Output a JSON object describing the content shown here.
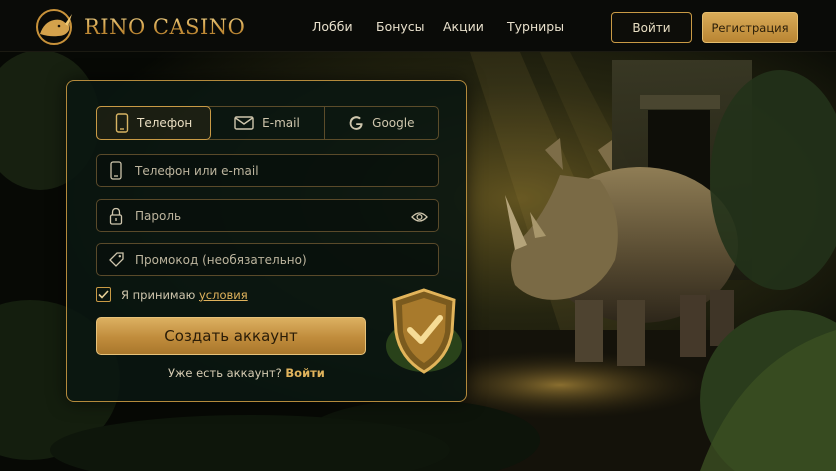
{
  "brand": {
    "name": "RINO CASINO"
  },
  "nav": {
    "items": [
      "Лобби",
      "Бонусы",
      "Акции",
      "Турниры"
    ]
  },
  "header": {
    "login_label": "Войти",
    "register_label": "Регистрация"
  },
  "form": {
    "tabs": [
      {
        "label": "Телефон",
        "icon": "phone-icon",
        "active": true
      },
      {
        "label": "E-mail",
        "icon": "mail-icon",
        "active": false
      },
      {
        "label": "Google",
        "icon": "google-icon",
        "active": false
      }
    ],
    "fields": {
      "login_placeholder": "Телефон или e-mail",
      "password_placeholder": "Пароль",
      "promo_placeholder": "Промокод (необязательно)"
    },
    "agree": {
      "text": "Я принимаю",
      "link": "условия",
      "checked": true
    },
    "submit_label": "Создать аккаунт",
    "have_account_text": "Уже есть аккаунт?",
    "have_account_link": "Войти"
  },
  "colors": {
    "gold": "#c99a45",
    "panel": "#0a1611",
    "background": "#0b0e08"
  }
}
